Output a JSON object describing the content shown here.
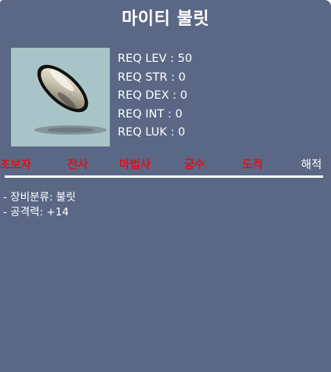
{
  "item": {
    "name": "마이티 불릿",
    "icon": "bullet-icon",
    "requirements": [
      {
        "text": "REQ LEV : 50"
      },
      {
        "text": "REQ STR : 0"
      },
      {
        "text": "REQ DEX : 0"
      },
      {
        "text": "REQ INT : 0"
      },
      {
        "text": "REQ LUK : 0"
      }
    ],
    "jobs": [
      {
        "label": "초보자",
        "usable": false
      },
      {
        "label": "전사",
        "usable": false
      },
      {
        "label": "마법사",
        "usable": false
      },
      {
        "label": "궁수",
        "usable": false
      },
      {
        "label": "도적",
        "usable": false
      },
      {
        "label": "해적",
        "usable": true
      }
    ],
    "details": [
      {
        "text": "- 장비분류: 불릿"
      },
      {
        "text": "- 공격력: +14"
      }
    ]
  },
  "colors": {
    "window_bg": "#5a6886",
    "image_bg": "#a9c4c8",
    "unusable_job": "#e0101a",
    "usable_job": "#ffffff",
    "text": "#ffffff"
  }
}
